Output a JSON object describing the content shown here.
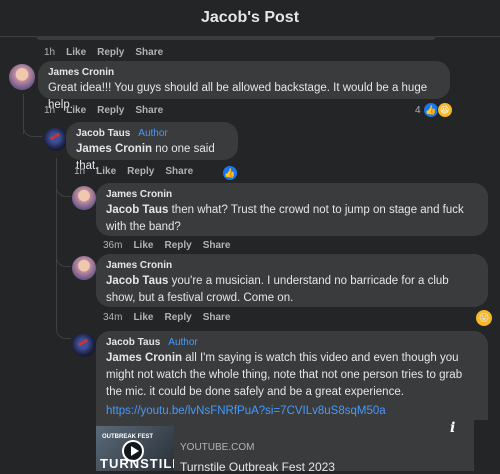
{
  "header": {
    "title": "Jacob's Post"
  },
  "top_actions": {
    "time": "1h",
    "like": "Like",
    "reply": "Reply",
    "share": "Share"
  },
  "comments": [
    {
      "name": "James Cronin",
      "author_badge": "",
      "text_prefix": "",
      "text": "Great idea!!! You guys should all be allowed backstage. It would be a huge help.",
      "actions": {
        "time": "1h",
        "like": "Like",
        "reply": "Reply",
        "share": "Share"
      },
      "reaction_count": "4"
    },
    {
      "name": "Jacob Taus",
      "author_badge": "Author",
      "text_prefix": "James Cronin",
      "text": " no one said that.",
      "actions": {
        "time": "1h",
        "like": "Like",
        "reply": "Reply",
        "share": "Share"
      }
    },
    {
      "name": "James Cronin",
      "text_prefix": "Jacob Taus",
      "text": " then what? Trust the crowd not to jump on stage and fuck with the band?",
      "actions": {
        "time": "36m",
        "like": "Like",
        "reply": "Reply",
        "share": "Share"
      }
    },
    {
      "name": "James Cronin",
      "text_prefix": "Jacob Taus",
      "text": " you're a musician. I understand no barricade for a club show, but a festival crowd. Come on.",
      "actions": {
        "time": "34m",
        "like": "Like",
        "reply": "Reply",
        "share": "Share"
      }
    },
    {
      "name": "Jacob Taus",
      "author_badge": "Author",
      "text_prefix": "James Cronin",
      "text": " all I'm saying is watch this video and even though you might not watch the whole thing, note that not one person tries to grab the mic. it could be done safely and be a great experience.",
      "link": "https://youtu.be/lvNsFNRfPuA?si=7CVILv8uS8sqM50a"
    }
  ],
  "link_preview": {
    "domain": "YOUTUBE.COM",
    "title": "Turnstile Outbreak Fest 2023",
    "thumb_top": "OUTBREAK FEST",
    "thumb_big": "TURNSTILE"
  },
  "colors": {
    "background": "#242526",
    "bubble": "#3a3b3c",
    "accent": "#4599ff"
  }
}
